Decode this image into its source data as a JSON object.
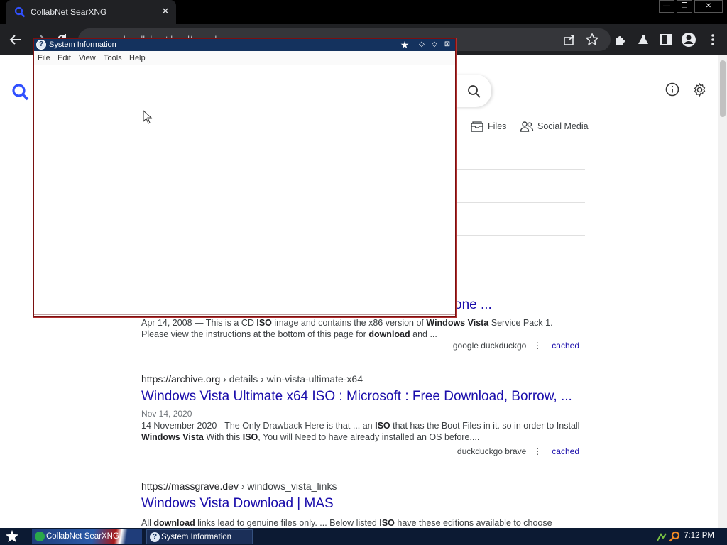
{
  "browser": {
    "tab_title": "CollabNet SearXNG",
    "url": "search.collabnet.local/search"
  },
  "categories": {
    "files": "Files",
    "social_media": "Social Media"
  },
  "results": [
    {
      "title": "one ...",
      "date_snippet": "Apr 14, 2008 — This is a CD ",
      "snippet_parts": [
        "Apr 14, 2008 — This is a CD ",
        "ISO",
        " image and contains the x86 version of ",
        "Windows Vista",
        " Service Pack 1. Please view the instructions at the bottom of this page for ",
        "download",
        " and ..."
      ],
      "engines": "google  duckduckgo",
      "cached": "cached"
    },
    {
      "url_host": "https://archive.org",
      "url_path": "› details › win-vista-ultimate-x64",
      "title": "Windows Vista Ultimate x64 ISO : Microsoft : Free Download, Borrow, ...",
      "date": "Nov 14, 2020",
      "snippet_parts": [
        "14 November 2020 - The Only Drawback Here is that ... an ",
        "ISO",
        " that has the Boot Files in it. so in order to Install ",
        "Windows Vista",
        " With this ",
        "ISO",
        ", You will Need to have already installed an OS before...."
      ],
      "engines": "duckduckgo  brave",
      "cached": "cached"
    },
    {
      "url_host": "https://massgrave.dev",
      "url_path": "› windows_vista_links",
      "title": "Windows Vista Download | MAS",
      "snippet_parts": [
        "All ",
        "download",
        " links lead to genuine files only. ... Below listed ",
        "ISO",
        " have these editions available to choose"
      ]
    }
  ],
  "sysinfo": {
    "title": "System Information",
    "menu": [
      "File",
      "Edit",
      "View",
      "Tools",
      "Help"
    ]
  },
  "taskbar": {
    "browser_task": "CollabNet SearXNG",
    "sysinfo_task": "System Information",
    "time": "7:12 PM"
  },
  "colors": {
    "link": "#1a0dab",
    "sysinfo_titlebar": "#14325e",
    "taskbar": "#0c1a33"
  }
}
